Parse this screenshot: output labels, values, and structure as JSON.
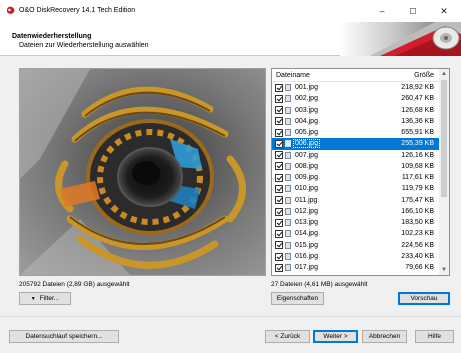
{
  "window": {
    "title": "O&O DiskRecovery 14.1 Tech Edition",
    "minimize": "–",
    "maximize": "☐",
    "close": "✕"
  },
  "header": {
    "title": "Datenwiederherstellung",
    "subtitle": "Dateien zur Wiederherstellung auswählen"
  },
  "list": {
    "col_name": "Dateiname",
    "col_size": "Größe",
    "selected_index": 5,
    "files": [
      {
        "name": "001.jpg",
        "size": "218,92 KB"
      },
      {
        "name": "002.jpg",
        "size": "260,47 KB"
      },
      {
        "name": "003.jpg",
        "size": "126,68 KB"
      },
      {
        "name": "004.jpg",
        "size": "136,36 KB"
      },
      {
        "name": "005.jpg",
        "size": "655,91 KB"
      },
      {
        "name": "006.jpg",
        "size": "255,39 KB"
      },
      {
        "name": "007.jpg",
        "size": "126,16 KB"
      },
      {
        "name": "008.jpg",
        "size": "109,68 KB"
      },
      {
        "name": "009.jpg",
        "size": "117,61 KB"
      },
      {
        "name": "010.jpg",
        "size": "119,79 KB"
      },
      {
        "name": "011.jpg",
        "size": "175,47 KB"
      },
      {
        "name": "012.jpg",
        "size": "166,10 KB"
      },
      {
        "name": "013.jpg",
        "size": "183,50 KB"
      },
      {
        "name": "014.jpg",
        "size": "102,23 KB"
      },
      {
        "name": "015.jpg",
        "size": "224,56 KB"
      },
      {
        "name": "016.jpg",
        "size": "233,40 KB"
      },
      {
        "name": "017.jpg",
        "size": "79,66 KB"
      }
    ]
  },
  "status": {
    "left": "205792 Dateien (2,89 GB) ausgewählt",
    "right": "27 Dateien (4,61 MB) ausgewählt"
  },
  "buttons": {
    "filter": "Filter...",
    "properties": "Eigenschaften",
    "preview": "Vorschau",
    "save_scan": "Datensuchlauf speichern...",
    "back": "< Zurück",
    "next": "Weiter >",
    "cancel": "Abbrechen",
    "help": "Hilfe"
  },
  "colors": {
    "selection": "#0078d7",
    "accent_red": "#d01f2a"
  }
}
